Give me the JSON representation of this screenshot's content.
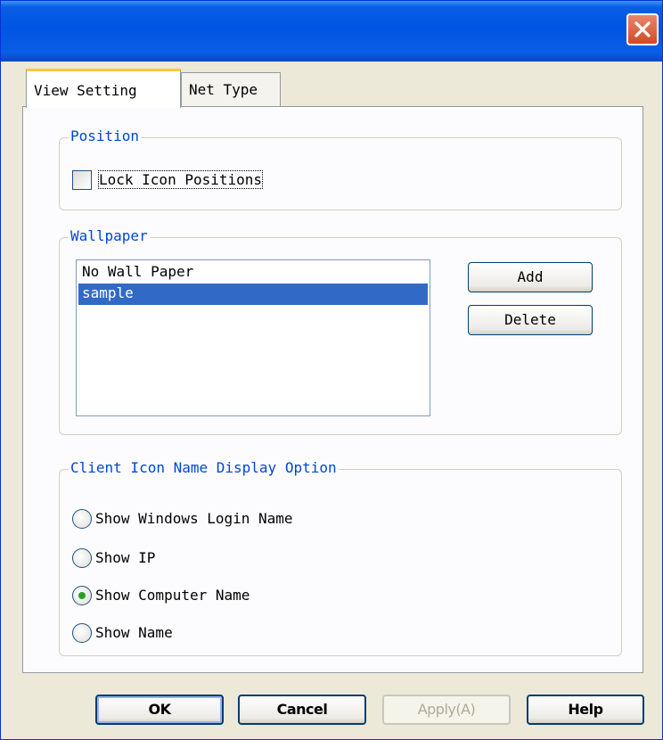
{
  "window": {
    "close_icon": "close-icon"
  },
  "tabs": [
    {
      "label": "View Setting",
      "active": true
    },
    {
      "label": "Net Type",
      "active": false
    }
  ],
  "position": {
    "title": "Position",
    "lock_icons_label": "Lock Icon Positions",
    "lock_icons_checked": false
  },
  "wallpaper": {
    "title": "Wallpaper",
    "items": [
      "No Wall Paper",
      "sample"
    ],
    "selected_index": 1,
    "add_label": "Add",
    "delete_label": "Delete"
  },
  "display_option": {
    "title": "Client Icon Name Display Option",
    "options": [
      "Show Windows Login Name",
      "Show IP",
      "Show Computer Name",
      "Show Name"
    ],
    "selected_index": 2
  },
  "footer": {
    "ok_label": "OK",
    "cancel_label": "Cancel",
    "apply_label": "Apply(A)",
    "help_label": "Help"
  },
  "colors": {
    "title_bar": "#0054e3",
    "group_title": "#0046d5",
    "selection": "#316ac5",
    "radio_dot": "#21a121",
    "close_button": "#d04a26"
  }
}
